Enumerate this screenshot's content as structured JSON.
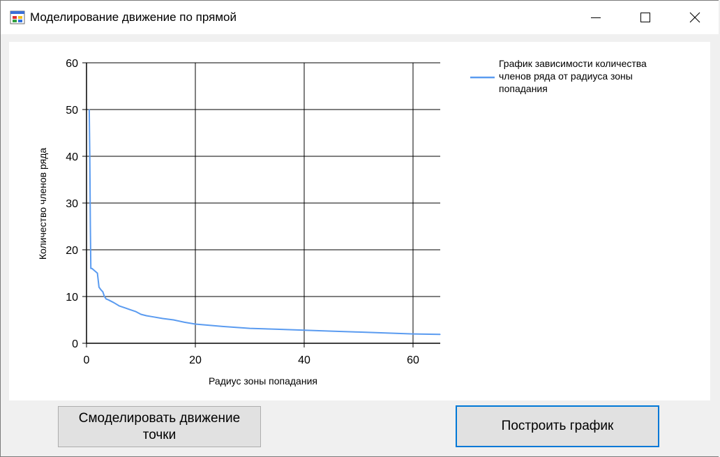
{
  "window": {
    "title": "Моделирование движение по прямой",
    "icon": "app-window-icon",
    "controls": [
      "minimize-icon",
      "maximize-icon",
      "close-icon"
    ]
  },
  "chart_data": {
    "type": "line",
    "xlabel": "Радиус зоны попадания",
    "ylabel": "Количество членов ряда",
    "xlim": [
      0,
      65
    ],
    "ylim": [
      0,
      60
    ],
    "x_ticks": [
      "0",
      "20",
      "40",
      "60"
    ],
    "y_ticks": [
      "0",
      "10",
      "20",
      "30",
      "40",
      "50",
      "60"
    ],
    "grid": true,
    "legend_position": "top-right",
    "series": [
      {
        "name": "График зависимости количества членов ряда от радиуса зоны попадания",
        "color": "#5a9bf0",
        "x": [
          0.5,
          0.6,
          0.7,
          0.8,
          1.0,
          1.5,
          2.0,
          2.3,
          2.6,
          3.0,
          3.3,
          3.6,
          4.0,
          5.0,
          6.0,
          7.0,
          8.0,
          9.0,
          10.0,
          11.0,
          12.0,
          14.0,
          16.0,
          18.0,
          20.0,
          25.0,
          30.0,
          35.0,
          40.0,
          45.0,
          50.0,
          55.0,
          60.0,
          65.0
        ],
        "y": [
          50,
          40,
          25,
          16,
          16,
          15.5,
          15,
          12,
          11.5,
          11,
          10,
          9.5,
          9.3,
          8.7,
          8,
          7.6,
          7.2,
          6.8,
          6.2,
          5.9,
          5.7,
          5.3,
          5.0,
          4.5,
          4.1,
          3.6,
          3.2,
          3.0,
          2.8,
          2.6,
          2.4,
          2.2,
          2.0,
          1.9
        ]
      }
    ]
  },
  "legend": {
    "lines": [
      "График зависимости количества",
      "членов ряда от радиуса зоны",
      "попадания"
    ]
  },
  "buttons": {
    "simulate_line1": "Смоделировать движение",
    "simulate_line2": "точки",
    "plot": "Построить график"
  }
}
